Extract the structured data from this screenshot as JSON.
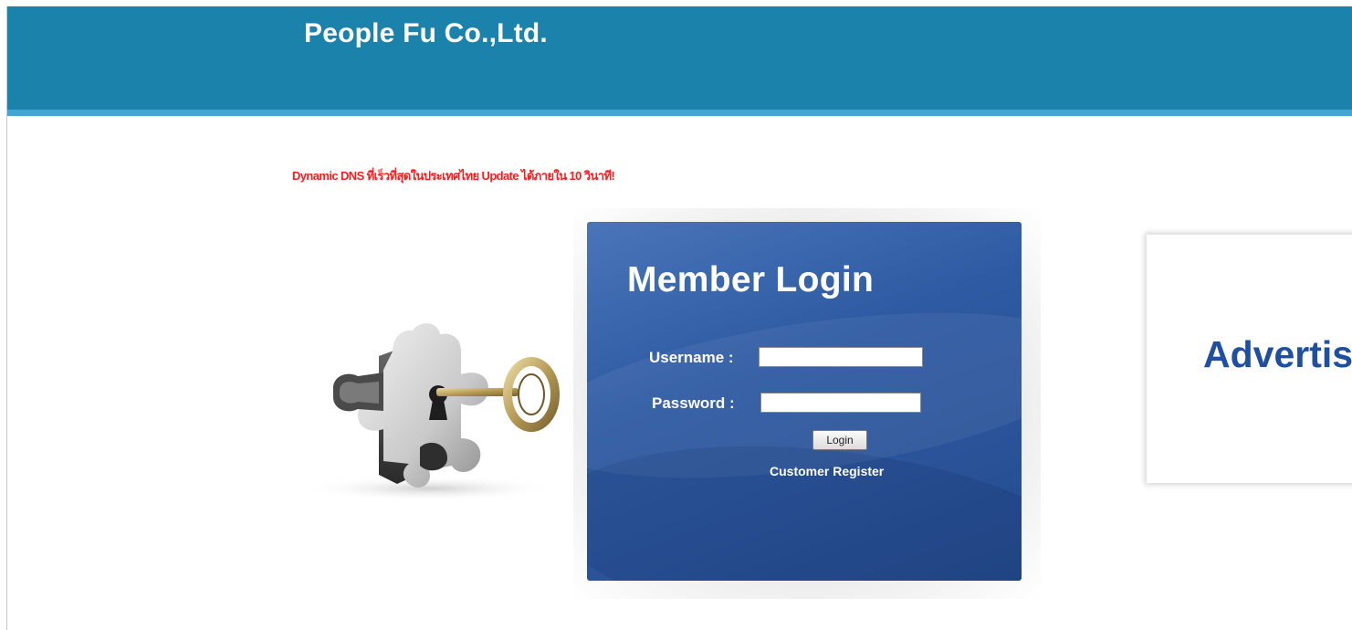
{
  "header": {
    "title": "People Fu Co.,Ltd."
  },
  "promo": {
    "text": "Dynamic DNS ที่เร็วที่สุดในประเทศไทย Update ได้ภายใน 10 วินาที!"
  },
  "login": {
    "title": "Member Login",
    "username_label": "Username :",
    "username_value": "",
    "password_label": "Password :",
    "password_value": "",
    "button_label": "Login",
    "register_label": "Customer Register"
  },
  "advertise": {
    "text": "Advertise"
  },
  "icons": {
    "illustration": "puzzle-key-icon"
  },
  "colors": {
    "header": "#1a82ab",
    "header_stripe": "#3fa6d6",
    "promo_text": "#ff1a1a",
    "panel": "#2d5aa2",
    "advertise_text": "#1e4fa0"
  }
}
